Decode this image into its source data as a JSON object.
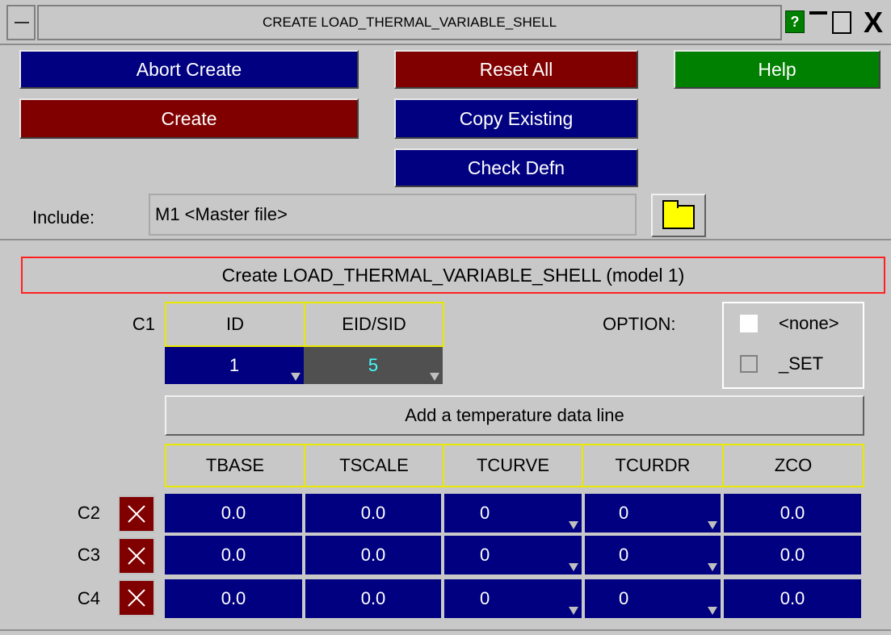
{
  "window": {
    "title": "CREATE LOAD_THERMAL_VARIABLE_SHELL",
    "help_glyph": "?",
    "close_glyph": "X"
  },
  "actions": {
    "abort_create": "Abort Create",
    "reset_all": "Reset All",
    "help": "Help",
    "create": "Create",
    "copy_existing": "Copy Existing",
    "check_defn": "Check Defn"
  },
  "include": {
    "label": "Include:",
    "value": "M1  <Master file>"
  },
  "panel": {
    "heading": "Create LOAD_THERMAL_VARIABLE_SHELL (model 1)"
  },
  "card1": {
    "label": "C1",
    "headers": [
      "ID",
      "EID/SID"
    ],
    "id_value": "1",
    "eid_value": "5"
  },
  "option": {
    "label": "OPTION:",
    "choices": [
      {
        "label": "<none>",
        "checked": true
      },
      {
        "label": "_SET",
        "checked": false
      }
    ]
  },
  "add_line_button": "Add a temperature data line",
  "temp_table": {
    "headers": [
      "TBASE",
      "TSCALE",
      "TCURVE",
      "TCURDR",
      "ZCO"
    ],
    "rows": [
      {
        "label": "C2",
        "values": [
          "0.0",
          "0.0",
          "0",
          "0",
          "0.0"
        ]
      },
      {
        "label": "C3",
        "values": [
          "0.0",
          "0.0",
          "0",
          "0",
          "0.0"
        ]
      },
      {
        "label": "C4",
        "values": [
          "0.0",
          "0.0",
          "0",
          "0",
          "0.0"
        ]
      }
    ]
  },
  "colors": {
    "panel_bg": "#c8c8c8",
    "blue": "#000080",
    "red": "#800000",
    "green": "#008000",
    "header_border": "#e8e800",
    "heading_border": "#ff2020"
  }
}
